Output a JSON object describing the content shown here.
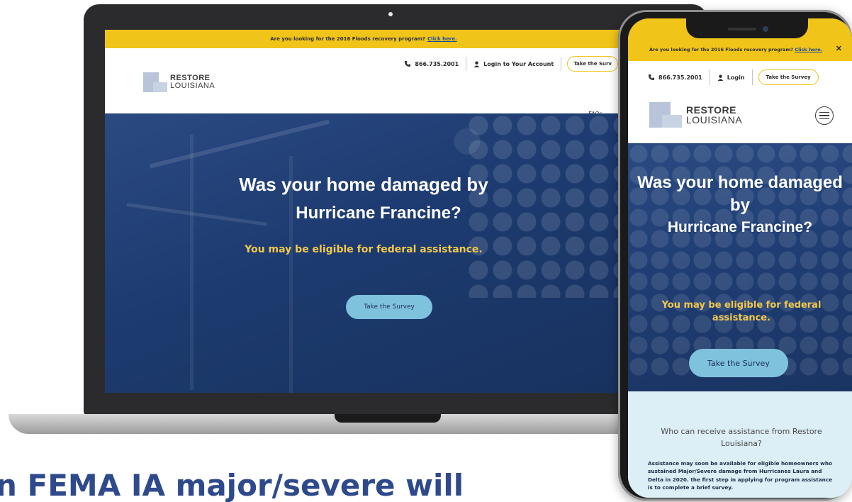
{
  "banner": {
    "text": "Are you looking for the 2016 Floods recovery program?",
    "link": "Click here."
  },
  "contact": {
    "phone": "866.735.2001",
    "login_laptop": "Login to Your Account",
    "login_mobile": "Login",
    "survey_pill_laptop": "Take the Surv",
    "survey_pill_mobile": "Take the Survey"
  },
  "logo": {
    "line1": "RESTORE",
    "line2": "LOUISIANA"
  },
  "nav": {
    "faqs": "FAQs"
  },
  "hero": {
    "title_line1_laptop": "Was your home damaged by",
    "title_line1_mobile": "Was your home damaged by",
    "title_line2": "Hurricane Francine?",
    "subtitle": "You may be eligible for federal assistance.",
    "cta": "Take the Survey"
  },
  "info": {
    "title": "Who can receive assistance from Restore Louisiana?",
    "body": "Assistance may soon be available for eligible homeowners who sustained Major/Severe damage from Hurricanes Laura and Delta in 2020. the first step in applying for program assistance is to complete a brief survey."
  },
  "close_glyph": "✕",
  "caption": "n FEMA IA major/severe will",
  "colors": {
    "banner": "#f0c419",
    "hero_bg": "#1f3d72",
    "cta_bg": "#7fc2de",
    "subtitle": "#f2c94c",
    "info_bg": "#dceef6",
    "caption": "#2f4a8c"
  },
  "icons": [
    "phone-icon",
    "user-icon",
    "hamburger-menu-icon",
    "close-icon",
    "state-logo-icon"
  ]
}
